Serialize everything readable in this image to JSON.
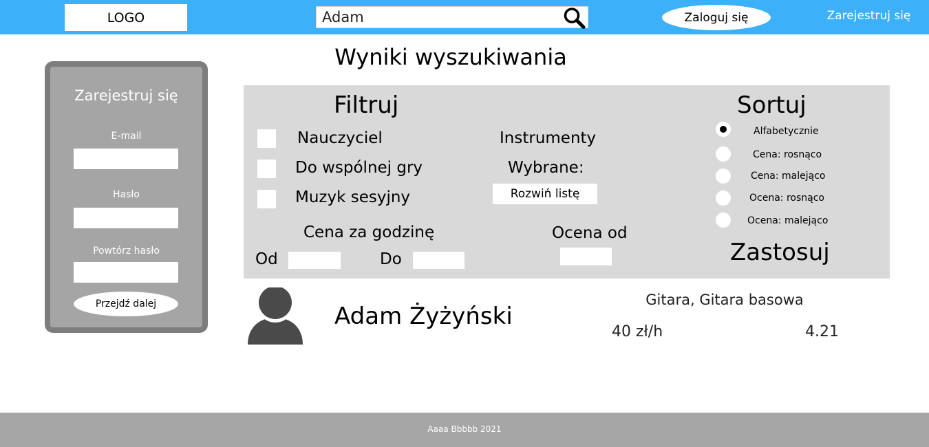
{
  "header": {
    "logo": "LOGO",
    "search_value": "Adam",
    "login_label": "Zaloguj się",
    "register_label": "Zarejestruj się"
  },
  "register_box": {
    "title": "Zarejestruj się",
    "email_label": "E-mail",
    "password_label": "Hasło",
    "repeat_password_label": "Powtórz hasło",
    "submit_label": "Przejdź dalej"
  },
  "main": {
    "title": "Wyniki wyszukiwania"
  },
  "filter": {
    "title": "Filtruj",
    "checkboxes": [
      {
        "label": "Nauczyciel",
        "checked": false
      },
      {
        "label": "Do wspólnej gry",
        "checked": false
      },
      {
        "label": "Muzyk sesyjny",
        "checked": false
      }
    ],
    "instruments_label": "Instrumenty",
    "selected_label": "Wybrane:",
    "dropdown_label": "Rozwiń listę",
    "price_label": "Cena za godzinę",
    "from_label": "Od",
    "to_label": "Do",
    "rating_label": "Ocena od"
  },
  "sort": {
    "title": "Sortuj",
    "options": [
      {
        "label": "Alfabetycznie",
        "selected": true
      },
      {
        "label": "Cena: rosnąco",
        "selected": false
      },
      {
        "label": "Cena: malejąco",
        "selected": false
      },
      {
        "label": "Ocena: rosnąco",
        "selected": false
      },
      {
        "label": "Ocena: malejąco",
        "selected": false
      }
    ],
    "apply_label": "Zastosuj"
  },
  "results": [
    {
      "name": "Adam Żyżyński",
      "instruments": "Gitara, Gitara basowa",
      "price": "40 zł/h",
      "rating": "4.21"
    }
  ],
  "footer": {
    "text": "Aaaa Bbbbb 2021"
  },
  "colors": {
    "header_bg": "#3cb1f9",
    "panel_bg": "#d9d9d9",
    "register_box_bg": "#a5a5a5",
    "register_box_border": "#7d7d7d",
    "footer_bg": "#a6a6a6"
  }
}
